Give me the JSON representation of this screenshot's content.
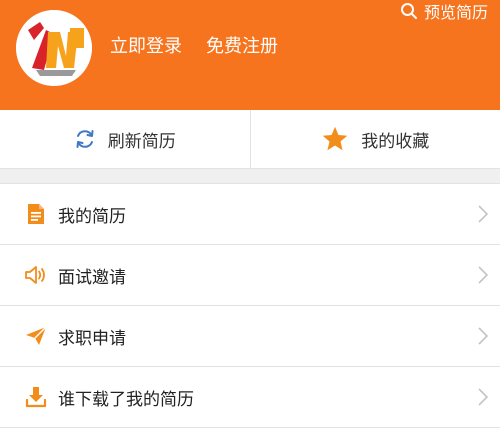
{
  "header": {
    "login_label": "立即登录",
    "register_label": "免费注册",
    "preview_label": "预览简历",
    "preview_icon": "search-icon",
    "accent_color": "#f7741f"
  },
  "quick_actions": [
    {
      "label": "刷新简历",
      "icon": "refresh-icon"
    },
    {
      "label": "我的收藏",
      "icon": "star-icon"
    }
  ],
  "menu": [
    {
      "label": "我的简历",
      "icon": "document-icon"
    },
    {
      "label": "面试邀请",
      "icon": "speaker-icon"
    },
    {
      "label": "求职申请",
      "icon": "paper-plane-icon"
    },
    {
      "label": "谁下载了我的简历",
      "icon": "download-icon"
    }
  ]
}
